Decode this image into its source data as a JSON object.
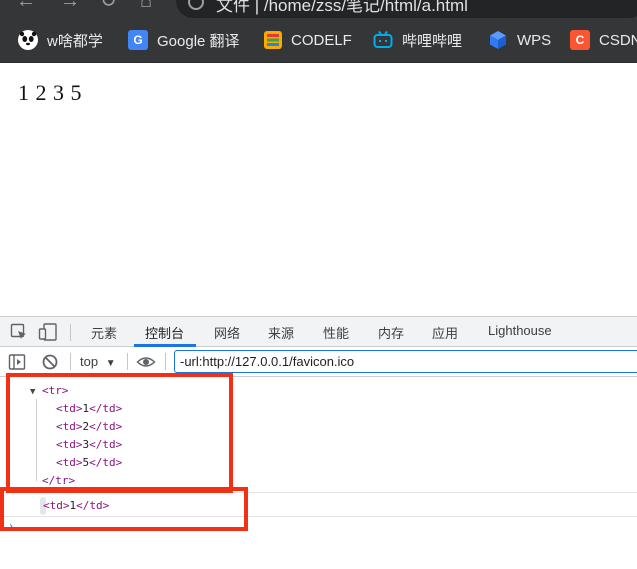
{
  "address_bar": {
    "url_text": "文件 | /home/zss/笔记/html/a.html"
  },
  "bookmarks": [
    {
      "label": "w啥都学",
      "icon": "panda-face-icon",
      "color": "#ffffff"
    },
    {
      "label": "Google 翻译",
      "icon": "google-translate-icon",
      "color": "#4285f4"
    },
    {
      "label": "CODELF",
      "icon": "codelf-icon",
      "color": "#f9ab00"
    },
    {
      "label": "哔哩哔哩",
      "icon": "bilibili-tv-icon",
      "color": "#00aeec"
    },
    {
      "label": "WPS",
      "icon": "wps-cube-icon",
      "color": "#2f7bf6"
    },
    {
      "label": "CSDN",
      "icon": "csdn-c-icon",
      "color": "#fc5531"
    }
  ],
  "page": {
    "content_text": "1 2 3 5"
  },
  "devtools": {
    "tabs": [
      "元素",
      "控制台",
      "网络",
      "来源",
      "性能",
      "内存",
      "应用",
      "Lighthouse"
    ],
    "active_tab": "控制台",
    "toolbar": {
      "context": "top",
      "filter_value": "-url:http://127.0.0.1/favicon.ico"
    },
    "console": {
      "tr_open": "<tr>",
      "cells": [
        "<td>1</td>",
        "<td>2</td>",
        "<td>3</td>",
        "<td>5</td>"
      ],
      "tr_close": "</tr>",
      "result": "<td>1</td>"
    },
    "accent_color": "#1a73e8",
    "highlight_color": "#f23114"
  }
}
